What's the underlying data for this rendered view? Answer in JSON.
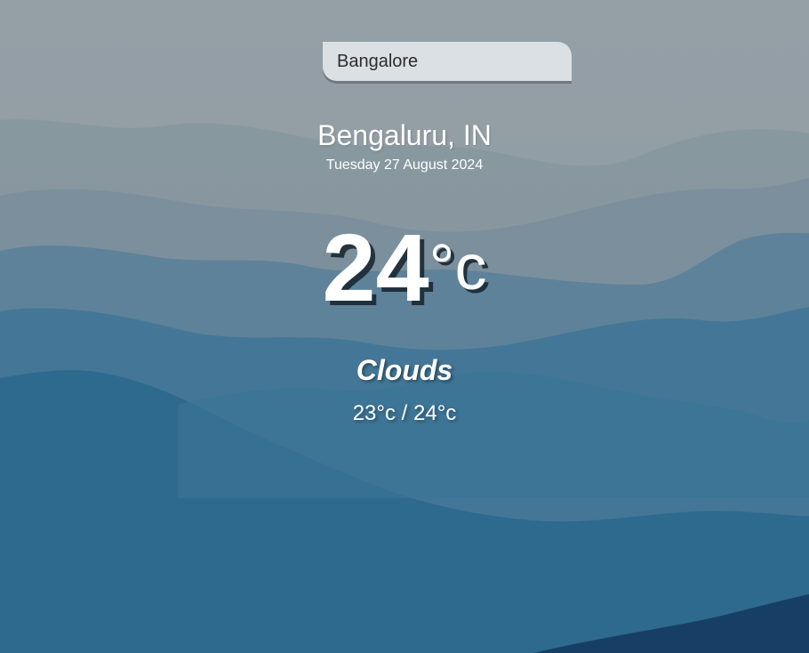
{
  "search": {
    "value": "Bangalore"
  },
  "location": {
    "city": "Bengaluru, IN",
    "date": "Tuesday 27 August 2024"
  },
  "weather": {
    "temperature": "24",
    "unit": "°c",
    "condition": "Clouds",
    "range": "23°c / 24°c"
  }
}
